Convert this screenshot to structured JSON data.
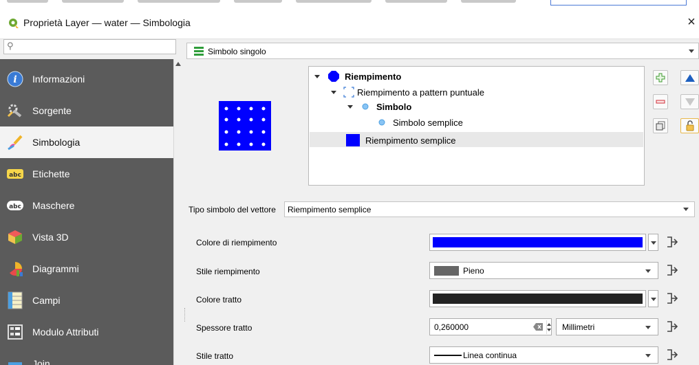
{
  "window": {
    "title": "Proprietà Layer — water — Simbologia",
    "close_label": "×"
  },
  "search": {
    "placeholder": ""
  },
  "sidebar": {
    "items": [
      {
        "label": "Informazioni",
        "icon": "info-icon"
      },
      {
        "label": "Sorgente",
        "icon": "source-icon"
      },
      {
        "label": "Simbologia",
        "icon": "paintbrush-icon",
        "active": true
      },
      {
        "label": "Etichette",
        "icon": "labels-abc-icon"
      },
      {
        "label": "Maschere",
        "icon": "masks-abc-icon"
      },
      {
        "label": "Vista 3D",
        "icon": "cube-3d-icon"
      },
      {
        "label": "Diagrammi",
        "icon": "diagram-icon"
      },
      {
        "label": "Campi",
        "icon": "fields-icon"
      },
      {
        "label": "Modulo Attributi",
        "icon": "form-icon"
      },
      {
        "label": "Join",
        "icon": "join-icon"
      }
    ]
  },
  "renderer": {
    "selected": "Simbolo singolo"
  },
  "tree": {
    "items": [
      {
        "label": "Riempimento",
        "bold": true
      },
      {
        "label": "Riempimento a pattern puntuale",
        "bold": false
      },
      {
        "label": "Simbolo",
        "bold": true
      },
      {
        "label": "Simbolo semplice",
        "bold": false
      },
      {
        "label": "Riempimento semplice",
        "bold": false,
        "selected": true
      }
    ]
  },
  "layer_type": {
    "label": "Tipo simbolo del vettore",
    "value": "Riempimento semplice"
  },
  "props": {
    "fill_color": {
      "label": "Colore di riempimento",
      "color": "#0000ff"
    },
    "fill_style": {
      "label": "Stile riempimento",
      "value": "Pieno"
    },
    "stroke_color": {
      "label": "Colore tratto",
      "color": "#232323"
    },
    "stroke_width": {
      "label": "Spessore tratto",
      "value": "0,260000",
      "unit": "Millimetri"
    },
    "stroke_style": {
      "label": "Stile tratto",
      "value": "Linea continua"
    }
  },
  "colors": {
    "sidebar_bg": "#5b5b5b",
    "accent_blue": "#0000ff"
  }
}
